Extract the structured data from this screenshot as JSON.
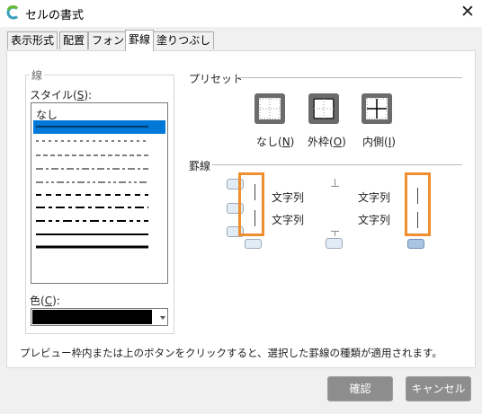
{
  "window": {
    "title": "セルの書式",
    "logo_icon": "app-logo-icon",
    "close_icon": "close-icon"
  },
  "tabs": [
    {
      "label": "表示形式",
      "active": false
    },
    {
      "label": "配置",
      "active": false
    },
    {
      "label": "フォント",
      "active": false
    },
    {
      "label": "罫線",
      "active": true
    },
    {
      "label": "塗りつぶし",
      "active": false
    }
  ],
  "line_group": {
    "title": "線",
    "style_label": "スタイル(",
    "style_key": "S",
    "style_suffix": "):",
    "styles": [
      "なし",
      "実線(細)",
      "点線(細)",
      "破線(細)",
      "一点鎖線(細)",
      "二点鎖線(細)",
      "破線(中)",
      "一点鎖線(中)",
      "二点鎖線(中)",
      "実線(中)",
      "実線(太)"
    ],
    "selected_index": 1,
    "color_label": "色(",
    "color_key": "C",
    "color_suffix": "):",
    "color_value": "#000000"
  },
  "presets": {
    "title": "プリセット",
    "items": [
      {
        "label": "なし(",
        "key": "N",
        "suffix": ")"
      },
      {
        "label": "外枠(",
        "key": "O",
        "suffix": ")"
      },
      {
        "label": "内側(",
        "key": "I",
        "suffix": ")"
      }
    ]
  },
  "border": {
    "title": "罫線",
    "preview_texts": [
      "文字列",
      "文字列",
      "文字列",
      "文字列"
    ]
  },
  "hint": "プレビュー枠内または上のボタンをクリックすると、選択した罫線の種類が適用されます。",
  "buttons": {
    "ok": "確認",
    "cancel": "キャンセル"
  },
  "colors": {
    "accent": "#0078d7",
    "highlight": "#ef8e2f",
    "preset_frame": "#6b6b6b"
  }
}
